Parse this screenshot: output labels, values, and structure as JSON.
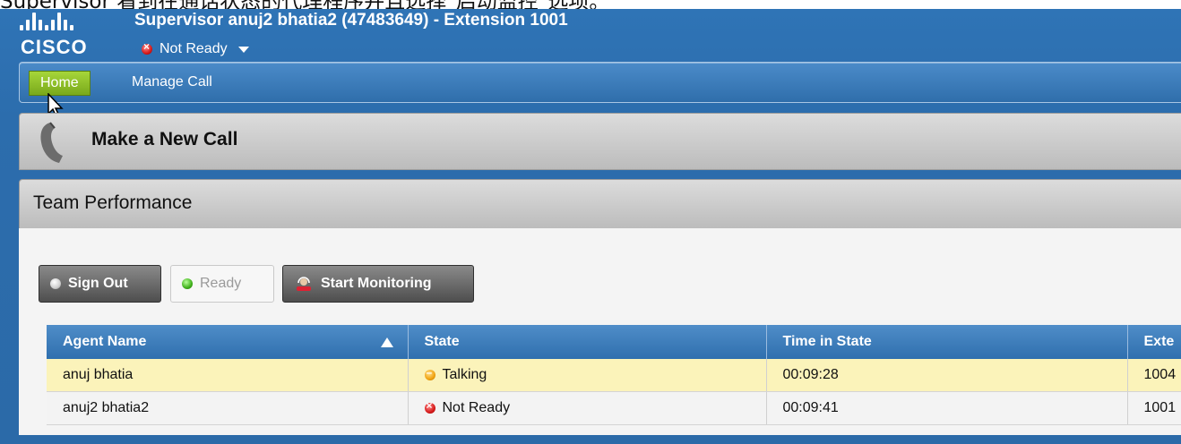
{
  "caption": "Supervisor 看到在通话状态的代理程序并且选择\"启动监控\"选项。",
  "header": {
    "logo_text": "CISCO",
    "title": "Supervisor anuj2 bhatia2 (47483649) - Extension 1001",
    "status": "Not Ready",
    "status_icon": "red-x-circle-icon"
  },
  "nav": {
    "tabs": [
      {
        "label": "Home",
        "active": true
      },
      {
        "label": "Manage Call",
        "active": false
      }
    ]
  },
  "make_call": {
    "label": "Make a New Call",
    "icon": "phone-handset-icon"
  },
  "team": {
    "title": "Team Performance",
    "buttons": {
      "sign_out": "Sign Out",
      "ready": "Ready",
      "start_monitoring": "Start Monitoring"
    },
    "columns": [
      "Agent Name",
      "State",
      "Time in State",
      "Exte"
    ],
    "rows": [
      {
        "agent": "anuj bhatia",
        "state": "Talking",
        "state_icon": "orange-circle-icon",
        "time": "00:09:28",
        "ext": "1004"
      },
      {
        "agent": "anuj2 bhatia2",
        "state": "Not Ready",
        "state_icon": "red-x-circle-icon",
        "time": "00:09:41",
        "ext": "1001"
      }
    ]
  },
  "colors": {
    "header_blue": "#2e72b4",
    "home_tab_green": "#8fc12a",
    "selected_row": "#fbf3ba"
  }
}
